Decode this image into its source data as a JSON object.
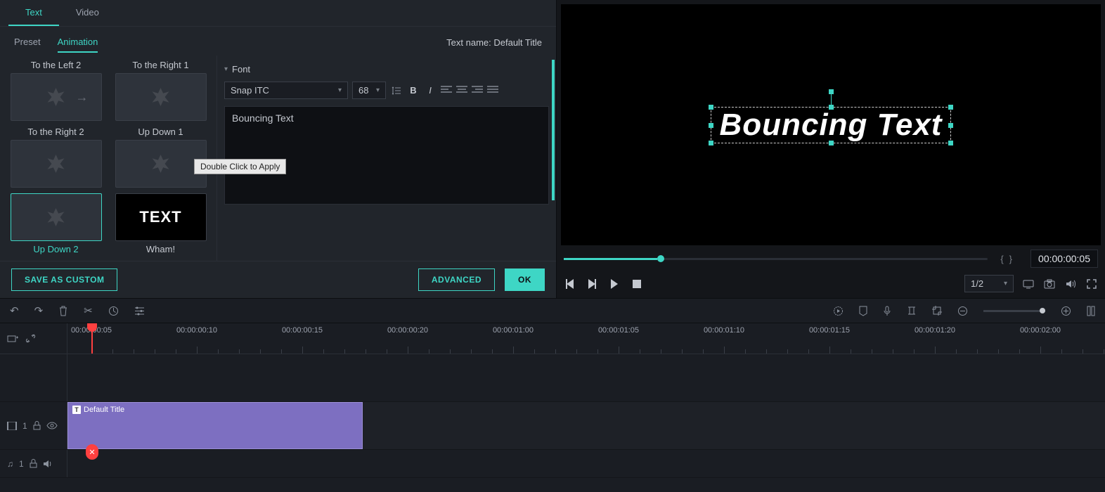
{
  "tabs": {
    "text": "Text",
    "video": "Video"
  },
  "subtabs": {
    "preset": "Preset",
    "animation": "Animation"
  },
  "textName": "Text name: Default Title",
  "presets": {
    "left2": "To the Left 2",
    "right1": "To the Right 1",
    "right2": "To the Right 2",
    "updown1": "Up Down 1",
    "updown2": "Up Down 2",
    "wham": "Wham!",
    "whamThumb": "TEXT"
  },
  "tooltip": "Double Click to Apply",
  "font": {
    "sectionLabel": "Font",
    "family": "Snap ITC",
    "size": "68",
    "textContent": "Bouncing Text"
  },
  "buttons": {
    "saveCustom": "SAVE AS CUSTOM",
    "advanced": "ADVANCED",
    "ok": "OK"
  },
  "preview": {
    "text": "Bouncing Text",
    "zoom": "1/2",
    "timecode": "00:00:00:05"
  },
  "timeline": {
    "ticks": [
      "00:00:00:05",
      "00:00:00:10",
      "00:00:00:15",
      "00:00:00:20",
      "00:00:01:00",
      "00:00:01:05",
      "00:00:01:10",
      "00:00:01:15",
      "00:00:01:20",
      "00:00:02:00"
    ],
    "clipLabel": "Default Title",
    "videoTrack": "1",
    "audioTrack": "1"
  }
}
